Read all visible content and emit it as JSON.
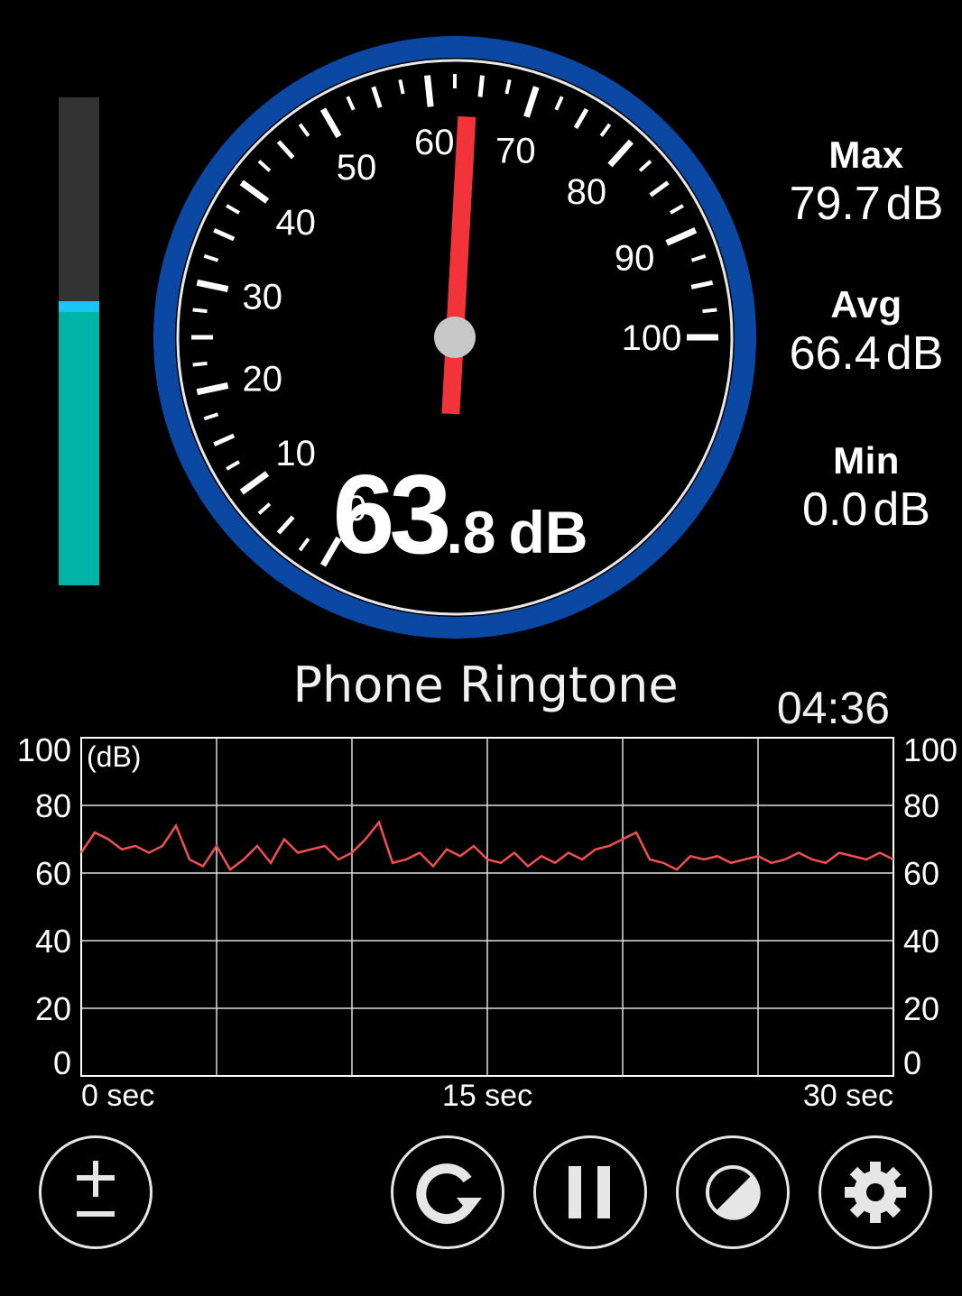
{
  "level_meter": {
    "level_fraction": 0.56,
    "fill_color": "#00b5a7",
    "cap_color": "#17c6f2"
  },
  "gauge": {
    "min": 0,
    "max": 100,
    "needle_value": 63.8,
    "tick_labels": [
      "0",
      "10",
      "20",
      "30",
      "40",
      "50",
      "60",
      "70",
      "80",
      "90",
      "100"
    ],
    "ring_color": "#0b48a3",
    "needle_color": "#f2343a"
  },
  "reading": {
    "integer": "63",
    "decimal": ".8",
    "unit": "dB"
  },
  "stats": {
    "max": {
      "label": "Max",
      "value": "79.7",
      "unit": "dB"
    },
    "avg": {
      "label": "Avg",
      "value": "66.4",
      "unit": "dB"
    },
    "min": {
      "label": "Min",
      "value": "0.0",
      "unit": "dB"
    }
  },
  "sound_label": "Phone Ringtone",
  "elapsed_time": "04:36",
  "chart_data": {
    "type": "line",
    "unit_label": "(dB)",
    "ylim": [
      0,
      100
    ],
    "yticks": [
      0,
      20,
      40,
      60,
      80,
      100
    ],
    "xlim": [
      0,
      30
    ],
    "xticks": [
      {
        "value": 0,
        "label": "0 sec"
      },
      {
        "value": 15,
        "label": "15 sec"
      },
      {
        "value": 30,
        "label": "30 sec"
      }
    ],
    "grid": true,
    "series": [
      {
        "color": "#f05050",
        "x": [
          0,
          0.5,
          1,
          1.5,
          2,
          2.5,
          3,
          3.5,
          4,
          4.5,
          5,
          5.5,
          6,
          6.5,
          7,
          7.5,
          8,
          8.5,
          9,
          9.5,
          10,
          10.5,
          11,
          11.5,
          12,
          12.5,
          13,
          13.5,
          14,
          14.5,
          15,
          15.5,
          16,
          16.5,
          17,
          17.5,
          18,
          18.5,
          19,
          19.5,
          20,
          20.5,
          21,
          21.5,
          22,
          22.5,
          23,
          23.5,
          24,
          24.5,
          25,
          25.5,
          26,
          26.5,
          27,
          27.5,
          28,
          28.5,
          29,
          29.5,
          30
        ],
        "y": [
          66,
          72,
          70,
          67,
          68,
          66,
          68,
          74,
          64,
          62,
          68,
          61,
          64,
          68,
          63,
          70,
          66,
          67,
          68,
          64,
          66,
          70,
          75,
          63,
          64,
          66,
          62,
          67,
          65,
          68,
          64,
          63,
          66,
          62,
          65,
          63,
          66,
          64,
          67,
          68,
          70,
          72,
          64,
          63,
          61,
          65,
          64,
          65,
          63,
          64,
          65,
          63,
          64,
          66,
          64,
          63,
          66,
          65,
          64,
          66,
          64
        ]
      }
    ]
  },
  "buttons": {
    "calibrate": {
      "icon": "plus-minus-icon"
    },
    "reset": {
      "icon": "refresh-icon"
    },
    "pause": {
      "icon": "pause-icon"
    },
    "theme": {
      "icon": "contrast-icon"
    },
    "settings": {
      "icon": "gear-icon"
    }
  }
}
